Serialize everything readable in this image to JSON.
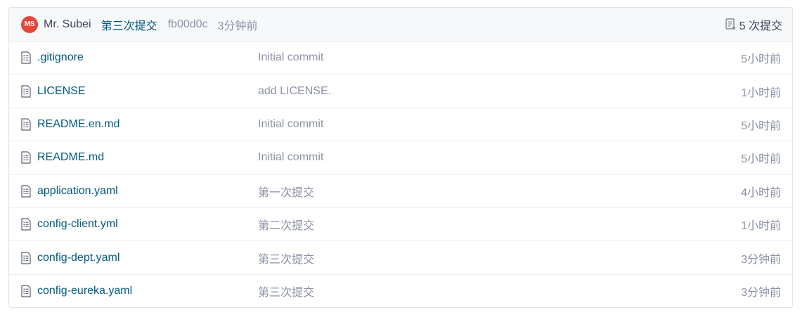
{
  "last_commit": {
    "avatar_initials": "MS",
    "avatar_color": "#e4463b",
    "author": "Mr. Subei",
    "message": "第三次提交",
    "hash": "fb00d0c",
    "time": "3分钟前",
    "commits_count_label": "5 次提交",
    "commits_icon": "commit-history-icon"
  },
  "files": [
    {
      "name": ".gitignore",
      "commit": "Initial commit",
      "time": "5小时前",
      "icon": "file-icon"
    },
    {
      "name": "LICENSE",
      "commit": "add LICENSE.",
      "time": "1小时前",
      "icon": "file-icon"
    },
    {
      "name": "README.en.md",
      "commit": "Initial commit",
      "time": "5小时前",
      "icon": "file-icon"
    },
    {
      "name": "README.md",
      "commit": "Initial commit",
      "time": "5小时前",
      "icon": "file-icon"
    },
    {
      "name": "application.yaml",
      "commit": "第一次提交",
      "time": "4小时前",
      "icon": "file-icon"
    },
    {
      "name": "config-client.yml",
      "commit": "第二次提交",
      "time": "1小时前",
      "icon": "file-icon"
    },
    {
      "name": "config-dept.yaml",
      "commit": "第三次提交",
      "time": "3分钟前",
      "icon": "file-icon"
    },
    {
      "name": "config-eureka.yaml",
      "commit": "第三次提交",
      "time": "3分钟前",
      "icon": "file-icon"
    }
  ],
  "colors": {
    "link": "#005980",
    "muted": "#8c92a4",
    "text": "#40485b",
    "header_bg": "#f7f8fa"
  }
}
